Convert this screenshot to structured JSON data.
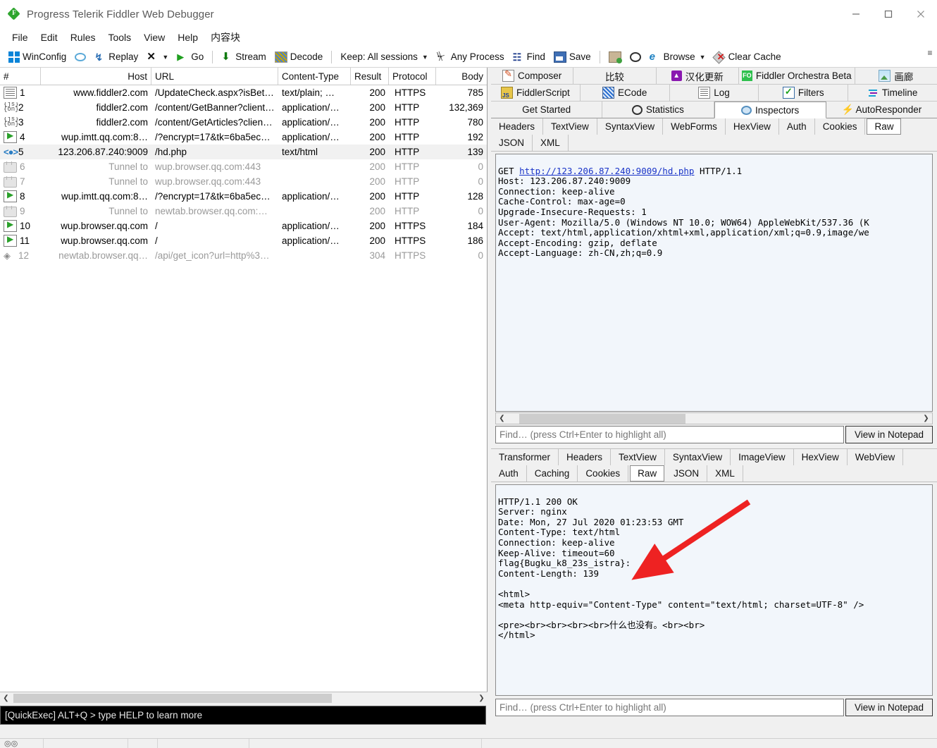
{
  "window": {
    "title": "Progress Telerik Fiddler Web Debugger",
    "icon": "fiddler-logo-icon",
    "minimize": "minimize-icon",
    "maximize": "maximize-icon",
    "close": "close-icon"
  },
  "menu": {
    "items": [
      {
        "label": "File"
      },
      {
        "label": "Edit"
      },
      {
        "label": "Rules"
      },
      {
        "label": "Tools"
      },
      {
        "label": "View"
      },
      {
        "label": "Help"
      },
      {
        "label": "内容块"
      }
    ]
  },
  "toolbar": {
    "items": [
      {
        "label": "WinConfig",
        "icon": "windows-logo-icon",
        "caret": false
      },
      {
        "label": "",
        "icon": "comment-bubble-icon",
        "caret": false
      },
      {
        "label": "Replay",
        "icon": "replay-icon",
        "caret": false
      },
      {
        "label": "",
        "icon": "remove-x-icon",
        "caret": true
      },
      {
        "label": "Go",
        "icon": "play-icon",
        "caret": false
      },
      {
        "label": "Stream",
        "icon": "stream-arrow-icon",
        "caret": false
      },
      {
        "label": "Decode",
        "icon": "decode-icon",
        "caret": false
      },
      {
        "label": "Keep: All sessions",
        "icon": "",
        "caret": true
      },
      {
        "label": "Any Process",
        "icon": "target-crosshair-icon",
        "caret": false
      },
      {
        "label": "Find",
        "icon": "binoculars-icon",
        "caret": false
      },
      {
        "label": "Save",
        "icon": "save-disk-icon",
        "caret": false
      },
      {
        "label": "",
        "icon": "clipboard-icon",
        "caret": false
      },
      {
        "label": "",
        "icon": "timer-clock-icon",
        "caret": false
      },
      {
        "label": "Browse",
        "icon": "internet-explorer-icon",
        "caret": true
      },
      {
        "label": "Clear Cache",
        "icon": "clear-cache-icon",
        "caret": false
      }
    ],
    "overflow": "toolbar-overflow-icon"
  },
  "sessions": {
    "columns": [
      "#",
      "Host",
      "URL",
      "Content-Type",
      "Result",
      "Protocol",
      "Body"
    ],
    "rows": [
      {
        "icon": "document-icon",
        "num": "1",
        "host": "www.fiddler2.com",
        "url": "/UpdateCheck.aspx?isBet…",
        "ctype": "text/plain; …",
        "result": "200",
        "protocol": "HTTPS",
        "body": "785",
        "dim": false,
        "selected": false
      },
      {
        "icon": "json-icon",
        "num": "2",
        "host": "fiddler2.com",
        "url": "/content/GetBanner?client…",
        "ctype": "application/…",
        "result": "200",
        "protocol": "HTTP",
        "body": "132,369",
        "dim": false,
        "selected": false
      },
      {
        "icon": "json-icon",
        "num": "3",
        "host": "fiddler2.com",
        "url": "/content/GetArticles?clien…",
        "ctype": "application/…",
        "result": "200",
        "protocol": "HTTP",
        "body": "780",
        "dim": false,
        "selected": false
      },
      {
        "icon": "request-icon",
        "num": "4",
        "host": "wup.imtt.qq.com:8…",
        "url": "/?encrypt=17&tk=6ba5ec…",
        "ctype": "application/…",
        "result": "200",
        "protocol": "HTTP",
        "body": "192",
        "dim": false,
        "selected": false
      },
      {
        "icon": "html-code-icon",
        "num": "5",
        "host": "123.206.87.240:9009",
        "url": "/hd.php",
        "ctype": "text/html",
        "result": "200",
        "protocol": "HTTP",
        "body": "139",
        "dim": false,
        "selected": true
      },
      {
        "icon": "lock-tunnel-icon",
        "num": "6",
        "host": "Tunnel to",
        "url": "wup.browser.qq.com:443",
        "ctype": "",
        "result": "200",
        "protocol": "HTTP",
        "body": "0",
        "dim": true,
        "selected": false
      },
      {
        "icon": "lock-tunnel-icon",
        "num": "7",
        "host": "Tunnel to",
        "url": "wup.browser.qq.com:443",
        "ctype": "",
        "result": "200",
        "protocol": "HTTP",
        "body": "0",
        "dim": true,
        "selected": false
      },
      {
        "icon": "request-icon",
        "num": "8",
        "host": "wup.imtt.qq.com:8…",
        "url": "/?encrypt=17&tk=6ba5ec…",
        "ctype": "application/…",
        "result": "200",
        "protocol": "HTTP",
        "body": "128",
        "dim": false,
        "selected": false
      },
      {
        "icon": "lock-tunnel-icon",
        "num": "9",
        "host": "Tunnel to",
        "url": "newtab.browser.qq.com:…",
        "ctype": "",
        "result": "200",
        "protocol": "HTTP",
        "body": "0",
        "dim": true,
        "selected": false
      },
      {
        "icon": "request-icon",
        "num": "10",
        "host": "wup.browser.qq.com",
        "url": "/",
        "ctype": "application/…",
        "result": "200",
        "protocol": "HTTPS",
        "body": "184",
        "dim": false,
        "selected": false
      },
      {
        "icon": "request-icon",
        "num": "11",
        "host": "wup.browser.qq.com",
        "url": "/",
        "ctype": "application/…",
        "result": "200",
        "protocol": "HTTPS",
        "body": "186",
        "dim": false,
        "selected": false
      },
      {
        "icon": "diamond-icon",
        "num": "12",
        "host": "newtab.browser.qq…",
        "url": "/api/get_icon?url=http%3…",
        "ctype": "",
        "result": "304",
        "protocol": "HTTPS",
        "body": "0",
        "dim": true,
        "selected": false
      }
    ]
  },
  "quickexec": {
    "text": "[QuickExec] ALT+Q > type HELP to learn more"
  },
  "right_tabs": {
    "row1": [
      {
        "label": "Composer",
        "icon": "composer-icon",
        "active": false
      },
      {
        "label": "比较",
        "icon": "",
        "active": false
      },
      {
        "label": "汉化更新",
        "icon": "update-icon",
        "active": false
      },
      {
        "label": "Fiddler Orchestra Beta",
        "icon": "fiddler-orchestra-icon",
        "active": false
      },
      {
        "label": "画廊",
        "icon": "gallery-icon",
        "active": false
      }
    ],
    "row2": [
      {
        "label": "FiddlerScript",
        "icon": "fiddlerscript-icon",
        "active": false
      },
      {
        "label": "ECode",
        "icon": "ecode-icon",
        "active": false
      },
      {
        "label": "Log",
        "icon": "log-icon",
        "active": false
      },
      {
        "label": "Filters",
        "icon": "filters-checkbox-icon",
        "active": false
      },
      {
        "label": "Timeline",
        "icon": "timeline-icon",
        "active": false
      }
    ],
    "row3": [
      {
        "label": "Get Started",
        "icon": "",
        "active": false
      },
      {
        "label": "Statistics",
        "icon": "statistics-icon",
        "active": false
      },
      {
        "label": "Inspectors",
        "icon": "inspectors-magnifier-icon",
        "active": true
      },
      {
        "label": "AutoResponder",
        "icon": "autoresponder-bolt-icon",
        "active": false
      }
    ]
  },
  "request_panel": {
    "tabs": [
      {
        "label": "Headers",
        "active": false
      },
      {
        "label": "TextView",
        "active": false
      },
      {
        "label": "SyntaxView",
        "active": false
      },
      {
        "label": "WebForms",
        "active": false
      },
      {
        "label": "HexView",
        "active": false
      },
      {
        "label": "Auth",
        "active": false
      },
      {
        "label": "Cookies",
        "active": false
      },
      {
        "label": "Raw",
        "active": true
      },
      {
        "label": "JSON",
        "active": false
      },
      {
        "label": "XML",
        "active": false
      }
    ],
    "request_line_method": "GET ",
    "request_line_url": "http://123.206.87.240:9009/hd.php",
    "request_line_version": " HTTP/1.1",
    "headers": "Host: 123.206.87.240:9009\nConnection: keep-alive\nCache-Control: max-age=0\nUpgrade-Insecure-Requests: 1\nUser-Agent: Mozilla/5.0 (Windows NT 10.0; WOW64) AppleWebKit/537.36 (K\nAccept: text/html,application/xhtml+xml,application/xml;q=0.9,image/we\nAccept-Encoding: gzip, deflate\nAccept-Language: zh-CN,zh;q=0.9",
    "find_placeholder": "Find… (press Ctrl+Enter to highlight all)",
    "notepad_button": "View in Notepad",
    "scroll_left_icon": "scroll-left-icon",
    "scroll_right_icon": "scroll-right-icon"
  },
  "response_panel": {
    "tabs": [
      {
        "label": "Transformer",
        "active": false
      },
      {
        "label": "Headers",
        "active": false
      },
      {
        "label": "TextView",
        "active": false
      },
      {
        "label": "SyntaxView",
        "active": false
      },
      {
        "label": "ImageView",
        "active": false
      },
      {
        "label": "HexView",
        "active": false
      },
      {
        "label": "WebView",
        "active": false
      },
      {
        "label": "Auth",
        "active": false
      },
      {
        "label": "Caching",
        "active": false
      },
      {
        "label": "Cookies",
        "active": false
      },
      {
        "label": "Raw",
        "active": true
      },
      {
        "label": "JSON",
        "active": false
      },
      {
        "label": "XML",
        "active": false
      }
    ],
    "body": "HTTP/1.1 200 OK\nServer: nginx\nDate: Mon, 27 Jul 2020 01:23:53 GMT\nContent-Type: text/html\nConnection: keep-alive\nKeep-Alive: timeout=60\nflag{Bugku_k8_23s_istra}:\nContent-Length: 139\n\n<html>\n<meta http-equiv=\"Content-Type\" content=\"text/html; charset=UTF-8\" />\n\n<pre><br><br><br><br>什么也没有。<br><br>\n</html>",
    "find_placeholder": "Find… (press Ctrl+Enter to highlight all)",
    "notepad_button": "View in Notepad"
  },
  "annotation": {
    "name": "red-arrow-annotation",
    "color": "#ee2222"
  }
}
